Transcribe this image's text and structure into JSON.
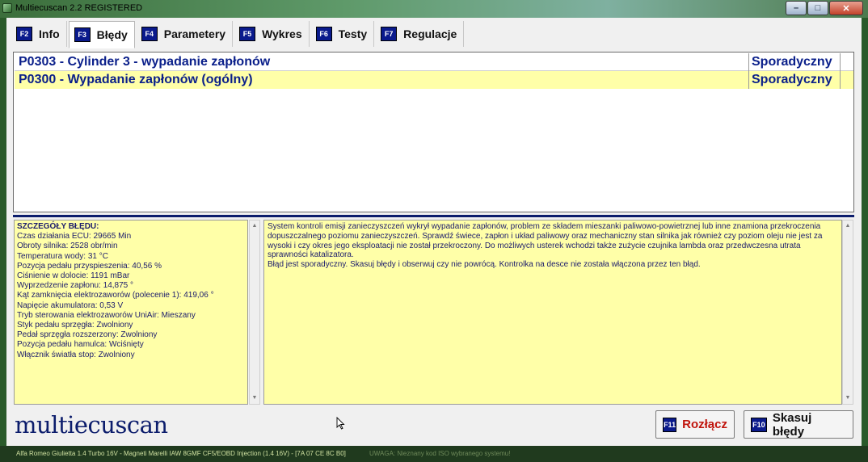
{
  "window": {
    "title": "Multiecuscan 2.2 REGISTERED",
    "minimize_symbol": "–",
    "maximize_symbol": "□",
    "close_symbol": "✕"
  },
  "tabs": [
    {
      "key": "F2",
      "label": "Info"
    },
    {
      "key": "F3",
      "label": "Błędy",
      "active": true
    },
    {
      "key": "F4",
      "label": "Parametery"
    },
    {
      "key": "F5",
      "label": "Wykres"
    },
    {
      "key": "F6",
      "label": "Testy"
    },
    {
      "key": "F7",
      "label": "Regulacje"
    }
  ],
  "faults": [
    {
      "code": "P0303 - Cylinder 3 - wypadanie zapłonów",
      "status": "Sporadyczny"
    },
    {
      "code": "P0300 - Wypadanie zapłonów (ogólny)",
      "status": "Sporadyczny"
    }
  ],
  "details": {
    "heading": "SZCZEGÓŁY BŁĘDU:",
    "lines": [
      "Czas działania ECU: 29665 Min",
      "Obroty silnika: 2528 obr/min",
      "Temperatura wody: 31 °C",
      "Pozycja pedału przyspieszenia: 40,56 %",
      "Ciśnienie w dolocie: 1191 mBar",
      "Wyprzedzenie zapłonu: 14,875 °",
      "Kąt zamknięcia elektrozaworów (polecenie 1): 419,06 °",
      "Napięcie akumulatora: 0,53 V",
      "Tryb sterowania elektrozaworów UniAir: Mieszany",
      "Styk pedału sprzęgła: Zwolniony",
      "Pedał sprzęgła rozszerzony: Zwolniony",
      "Pozycja pedału hamulca: Wciśnięty",
      "Włącznik światła stop: Zwolniony"
    ]
  },
  "description": {
    "paragraph1": "System kontroli emisji zanieczyszczeń wykrył wypadanie zapłonów, problem ze składem mieszanki paliwowo-powietrznej lub inne znamiona przekroczenia dopuszczalnego poziomu zanieczyszczeń. Sprawdź świece, zapłon i układ paliwowy oraz mechaniczny stan silnika jak również czy poziom oleju nie jest za wysoki i czy okres jego eksploatacji nie został przekroczony. Do możliwych usterek wchodzi także zużycie czujnika lambda oraz przedwczesna utrata sprawności katalizatora.",
    "paragraph2": "Błąd jest sporadyczny. Skasuj błędy i obserwuj czy nie powrócą. Kontrolka na desce nie została włączona przez ten błąd."
  },
  "logo": "multiecuscan",
  "buttons": {
    "disconnect": {
      "key": "F11",
      "label": "Rozłącz"
    },
    "clear": {
      "key": "F10",
      "label": "Skasuj błędy"
    }
  },
  "statusbar": {
    "vehicle_info": "Alfa Romeo Giulietta 1.4 Turbo 16V - Magneti Marelli IAW 8GMF CF5/EOBD Injection (1.4 16V) - [7A 07 CE 8C B0]",
    "warning": "UWAGA: Nieznany kod ISO wybranego systemu!"
  },
  "colors": {
    "accent_blue": "#0c1d6c",
    "fault_text": "#0a1f8a",
    "yellow_panel": "#ffffa8",
    "disconnect_red": "#c0140c"
  }
}
